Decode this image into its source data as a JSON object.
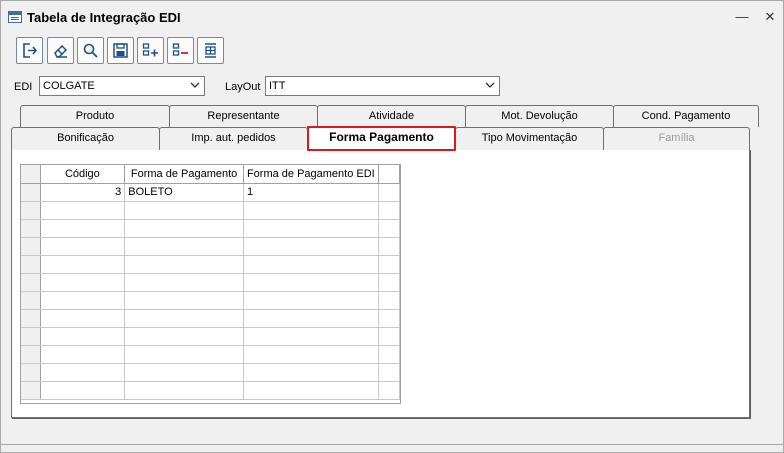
{
  "window": {
    "title": "Tabela de Integração EDI",
    "minimize": "—",
    "close": "✕"
  },
  "toolbar": {
    "buttons": [
      {
        "name": "exit-button",
        "icon": "exit-icon"
      },
      {
        "name": "clear-button",
        "icon": "eraser-icon"
      },
      {
        "name": "search-button",
        "icon": "search-icon"
      },
      {
        "name": "save-button",
        "icon": "save-icon"
      },
      {
        "name": "add-row-button",
        "icon": "add-row-icon"
      },
      {
        "name": "remove-row-button",
        "icon": "remove-row-icon"
      },
      {
        "name": "insert-row-button",
        "icon": "insert-row-icon"
      }
    ]
  },
  "filters": {
    "edi_label": "EDI",
    "edi_value": "COLGATE",
    "layout_label": "LayOut",
    "layout_value": "ITT"
  },
  "tabs_row1": [
    "Produto",
    "Representante",
    "Atividade",
    "Mot. Devolução",
    "Cond. Pagamento"
  ],
  "tabs_row2": [
    "Bonificação",
    "Imp. aut. pedidos",
    "Forma Pagamento",
    "Tipo Movimentação",
    "Família"
  ],
  "active_tab": "Forma Pagamento",
  "disabled_tab": "Família",
  "grid": {
    "columns": [
      "Código",
      "Forma de Pagamento",
      "Forma de Pagamento EDI"
    ],
    "rows": [
      [
        "3",
        "BOLETO",
        "1"
      ]
    ],
    "empty_rows": 11
  },
  "colors": {
    "active_tab_border": "#d9191c",
    "icon_blue": "#1f4f8f"
  }
}
